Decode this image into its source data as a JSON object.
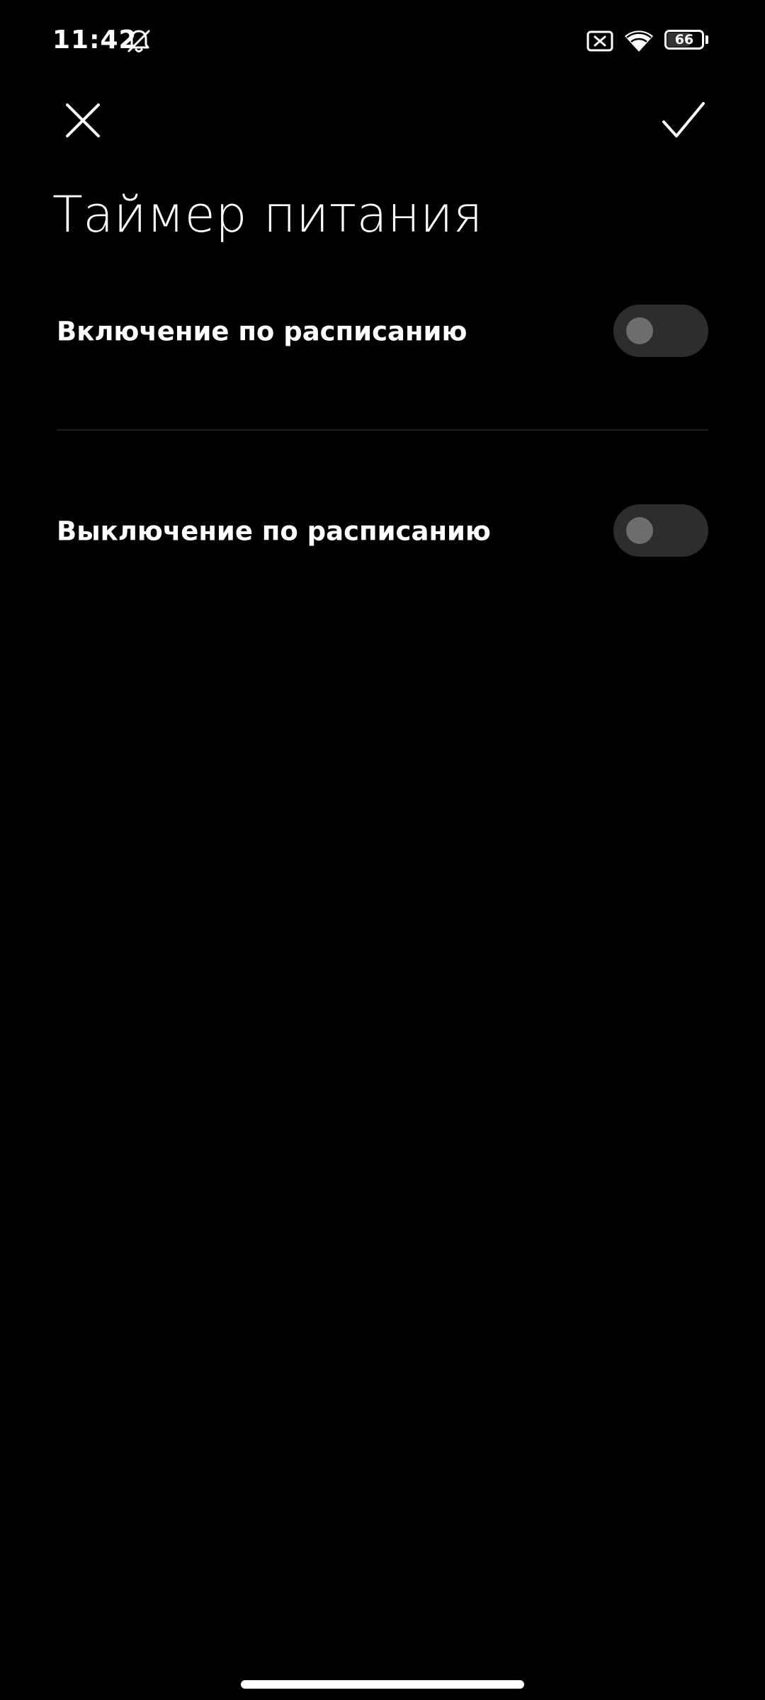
{
  "status_bar": {
    "time": "11:42",
    "battery_level": "66",
    "battery_fraction": 0.66,
    "icons": [
      "bell-off-icon",
      "sim-x-icon",
      "wifi-icon",
      "battery-icon"
    ]
  },
  "action_bar": {
    "close_icon": "close-icon",
    "confirm_icon": "checkmark-icon"
  },
  "page": {
    "title": "Таймер питания"
  },
  "settings": [
    {
      "label": "Включение по расписанию",
      "enabled": false
    },
    {
      "label": "Выключение по расписанию",
      "enabled": false
    }
  ],
  "colors": {
    "background": "#000000",
    "text": "#ffffff",
    "toggle_track_off": "#2d2d2d",
    "toggle_knob_off": "#6d6d6d",
    "toggle_track_on": "#3482ff",
    "divider": "#1f1f1f"
  }
}
